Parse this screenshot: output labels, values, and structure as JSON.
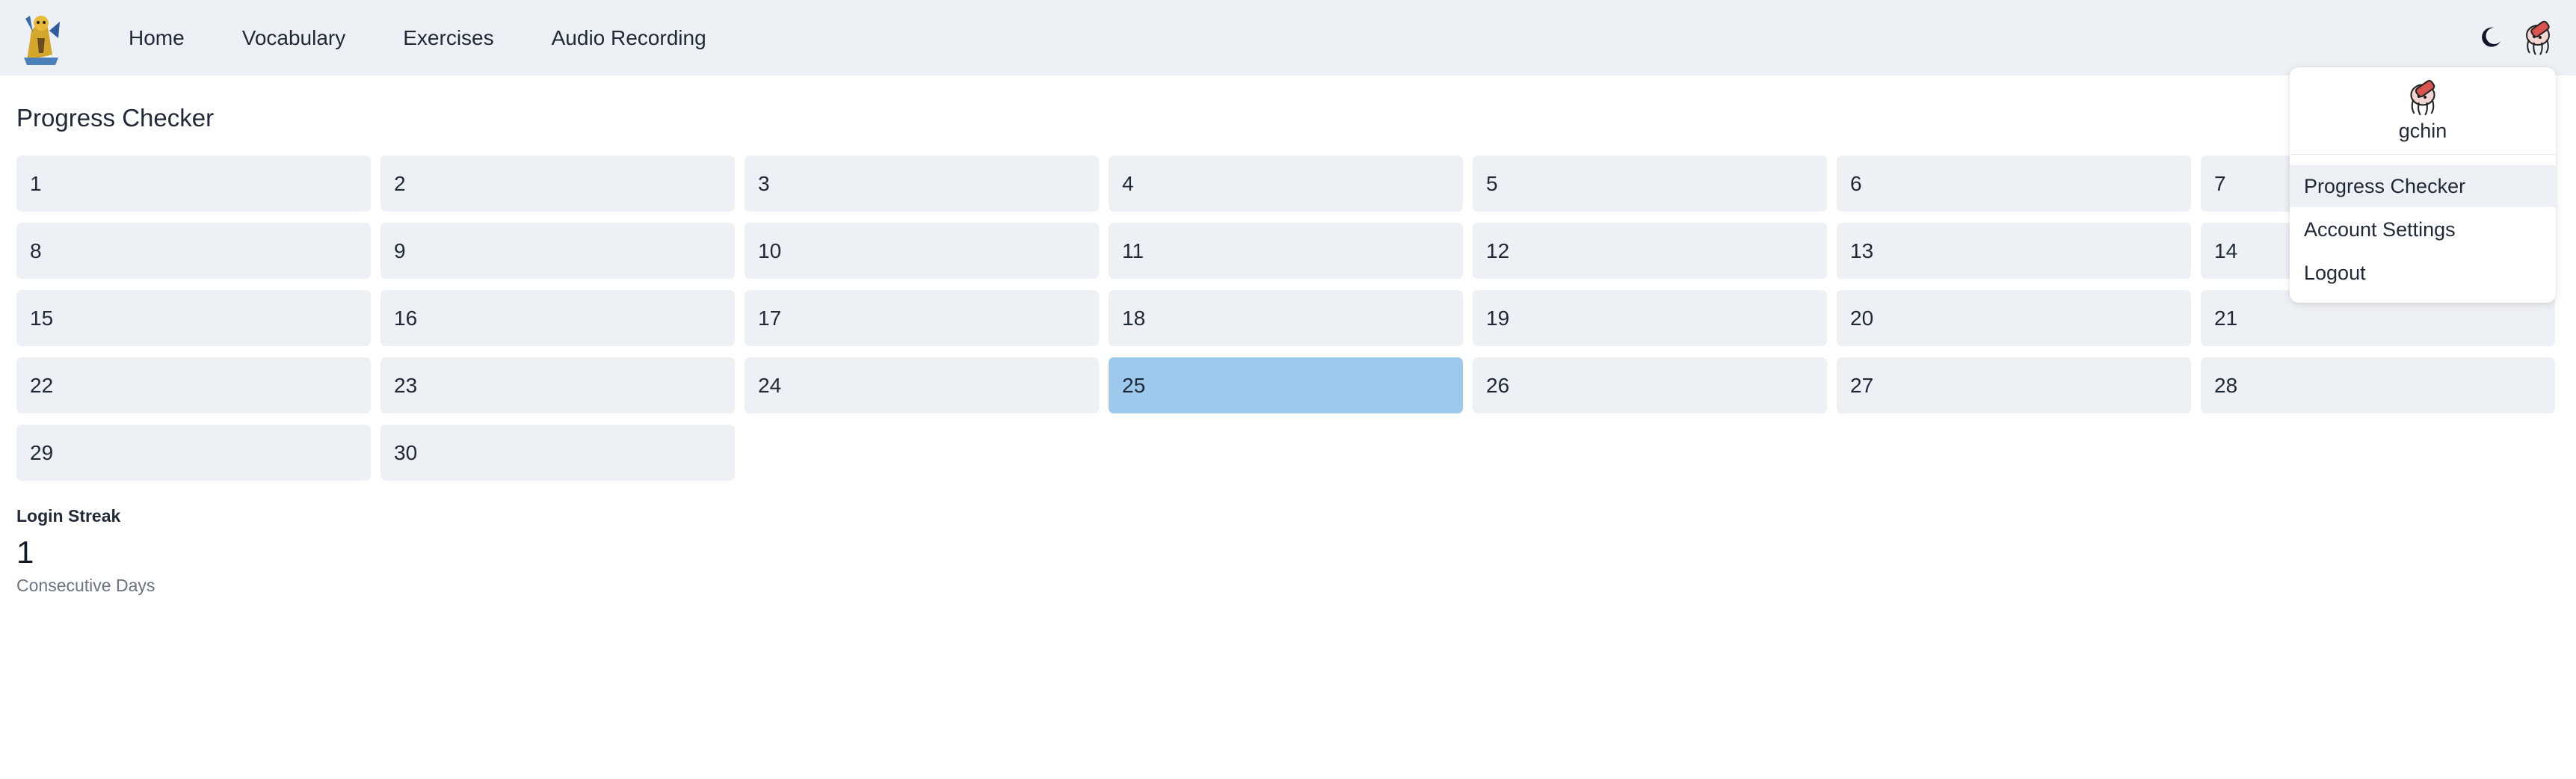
{
  "nav": {
    "links": [
      "Home",
      "Vocabulary",
      "Exercises",
      "Audio Recording"
    ]
  },
  "icons": {
    "logo": "app-logo",
    "theme": "moon-icon",
    "avatar": "user-avatar"
  },
  "page": {
    "title": "Progress Checker"
  },
  "days": {
    "labels": [
      "1",
      "2",
      "3",
      "4",
      "5",
      "6",
      "7",
      "8",
      "9",
      "10",
      "11",
      "12",
      "13",
      "14",
      "15",
      "16",
      "17",
      "18",
      "19",
      "20",
      "21",
      "22",
      "23",
      "24",
      "25",
      "26",
      "27",
      "28",
      "29",
      "30"
    ],
    "current": "25"
  },
  "streak": {
    "label": "Login Streak",
    "value": "1",
    "unit": "Consecutive Days"
  },
  "dropdown": {
    "username": "gchin",
    "items": [
      "Progress Checker",
      "Account Settings",
      "Logout"
    ],
    "active": "Progress Checker"
  },
  "colors": {
    "navbar": "#edf0f4",
    "tile": "#edf0f4",
    "tile_current": "#9cc9ec"
  }
}
